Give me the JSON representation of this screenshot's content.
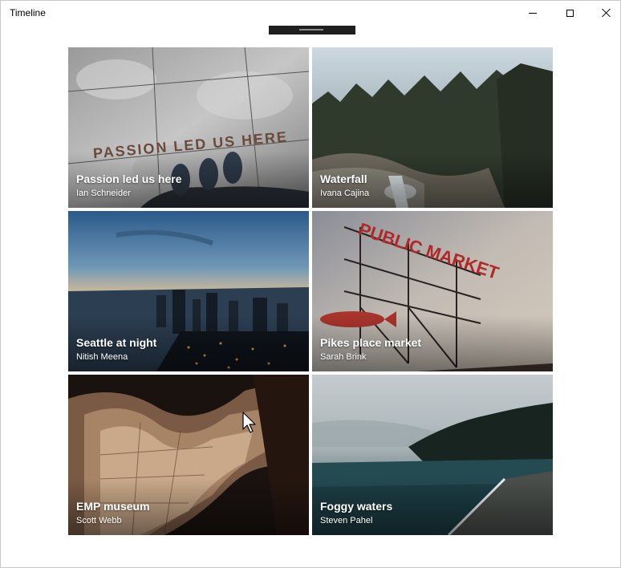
{
  "window": {
    "title": "Timeline"
  },
  "cards": [
    {
      "title": "Passion led us here",
      "author": "Ian Schneider",
      "sign_text": "PASSION LED US HERE"
    },
    {
      "title": "Waterfall",
      "author": "Ivana Cajina"
    },
    {
      "title": "Seattle at night",
      "author": "Nitish Meena"
    },
    {
      "title": "Pikes place market",
      "author": "Sarah Brink",
      "sign_text": "PUBLIC MARKET"
    },
    {
      "title": "EMP museum",
      "author": "Scott Webb"
    },
    {
      "title": "Foggy waters",
      "author": "Steven Pahel"
    }
  ]
}
